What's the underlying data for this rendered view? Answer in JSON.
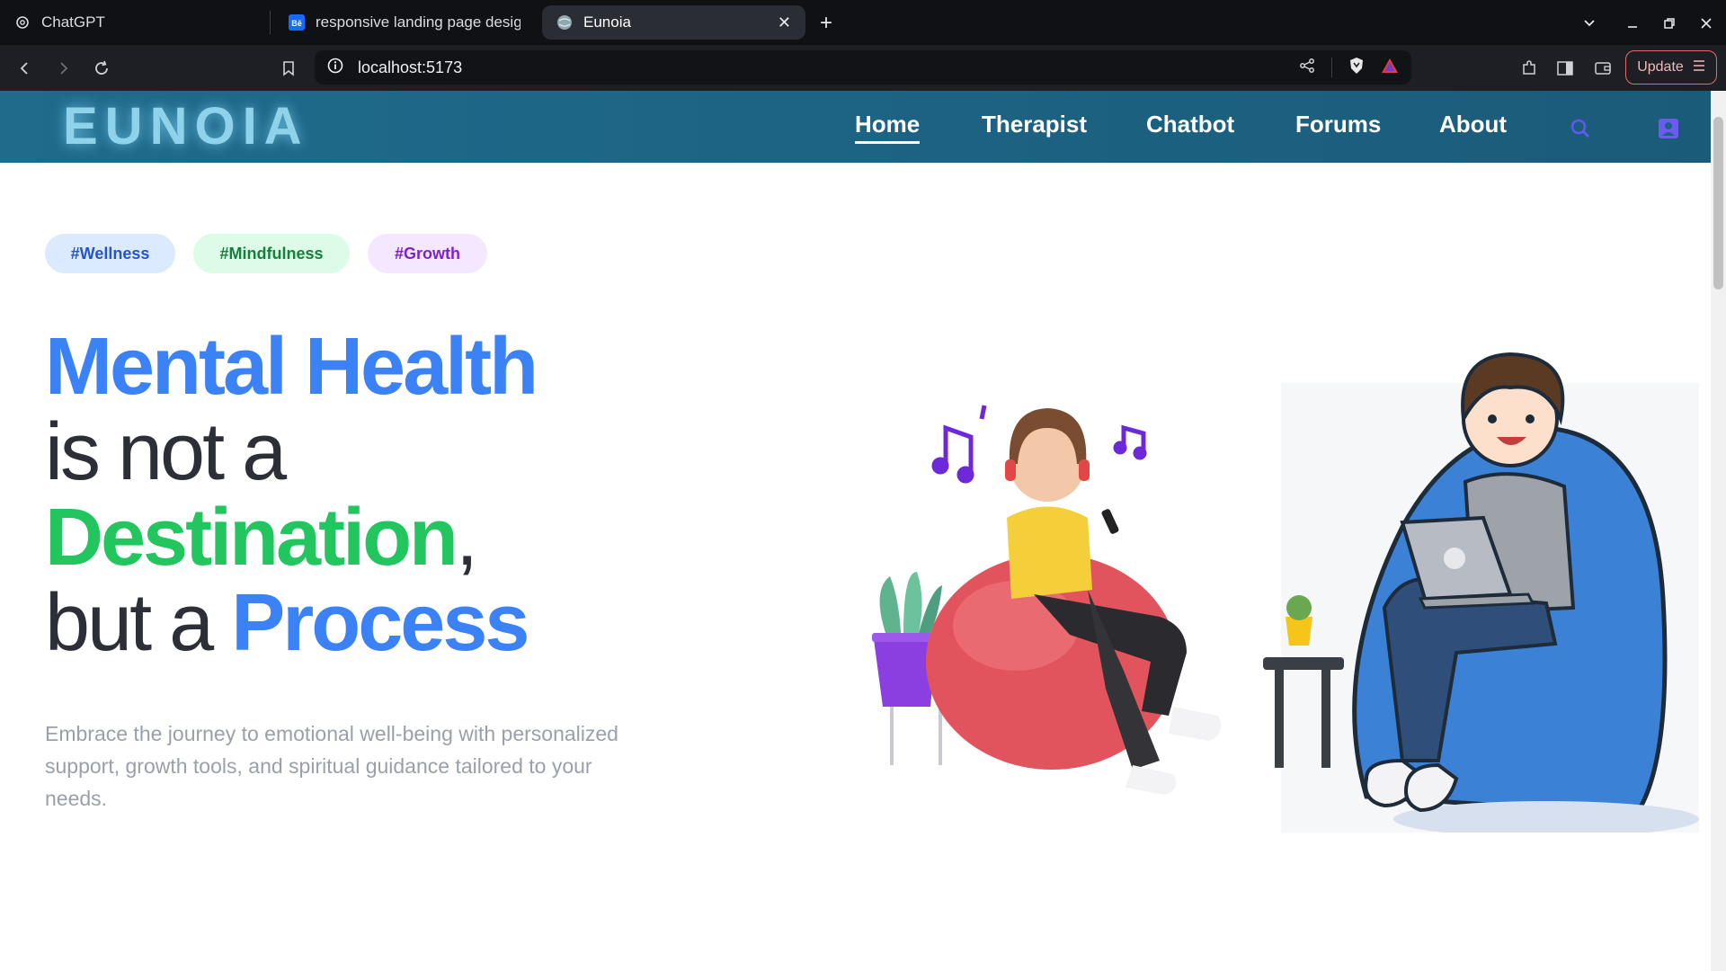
{
  "browser": {
    "tabs": [
      {
        "label": "ChatGPT",
        "icon": "chatgpt-icon",
        "active": false
      },
      {
        "label": "responsive landing page design",
        "icon": "behance-icon",
        "active": false
      },
      {
        "label": "Eunoia",
        "icon": "globe-icon",
        "active": true
      }
    ],
    "url": "localhost:5173",
    "update_label": "Update"
  },
  "site": {
    "logo": "EUNOIA",
    "nav": [
      {
        "label": "Home",
        "active": true
      },
      {
        "label": "Therapist",
        "active": false
      },
      {
        "label": "Chatbot",
        "active": false
      },
      {
        "label": "Forums",
        "active": false
      },
      {
        "label": "About",
        "active": false
      }
    ],
    "icons": [
      "search-icon",
      "profile-icon"
    ]
  },
  "hero": {
    "tags": [
      "#Wellness",
      "#Mindfulness",
      "#Growth"
    ],
    "headline": {
      "line1": "Mental Health",
      "line2": "is not a",
      "line3_word": "Destination",
      "line3_punct": ",",
      "line4_prefix": "but a",
      "line4_word": "Process"
    },
    "description": "Embrace the journey to emotional well-being with personalized support, growth tools, and spiritual guidance tailored to your needs."
  },
  "colors": {
    "nav_bg": "#1d6283",
    "accent_blue": "#3b82f6",
    "accent_green": "#22c55e",
    "text_dark": "#2c2f36",
    "text_muted": "#9aa0aa"
  }
}
